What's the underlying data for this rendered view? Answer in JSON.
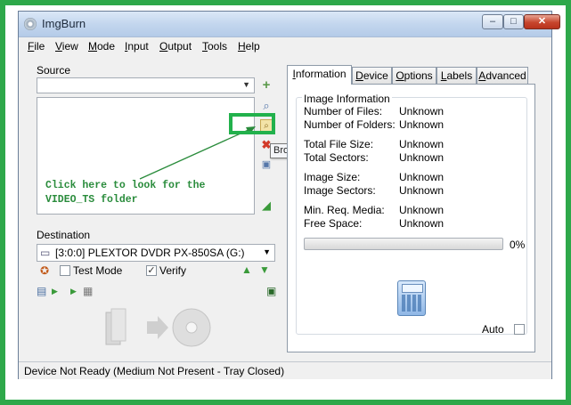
{
  "window": {
    "title": "ImgBurn",
    "min_label": "–",
    "max_label": "□",
    "close_label": "✕"
  },
  "menu": [
    {
      "mnemonic": "F",
      "rest": "ile"
    },
    {
      "mnemonic": "V",
      "rest": "iew"
    },
    {
      "mnemonic": "M",
      "rest": "ode"
    },
    {
      "mnemonic": "I",
      "rest": "nput"
    },
    {
      "mnemonic": "O",
      "rest": "utput"
    },
    {
      "mnemonic": "T",
      "rest": "ools"
    },
    {
      "mnemonic": "H",
      "rest": "elp"
    }
  ],
  "source": {
    "label": "Source",
    "tooltip": "Browse for a folder...",
    "annotation_line1": "Click here to look for the",
    "annotation_line2": "VIDEO_TS folder"
  },
  "destination": {
    "label": "Destination",
    "drive": "[3:0:0] PLEXTOR DVDR   PX-850SA (G:)",
    "test_mode_label": "Test Mode",
    "test_mode_checked": false,
    "verify_label": "Verify",
    "verify_checked": true
  },
  "tabs": [
    {
      "mnemonic": "I",
      "rest": "nformation",
      "active": true
    },
    {
      "mnemonic": "D",
      "rest": "evice"
    },
    {
      "mnemonic": "O",
      "rest": "ptions"
    },
    {
      "mnemonic": "L",
      "rest": "abels"
    },
    {
      "mnemonic": "A",
      "rest": "dvanced"
    }
  ],
  "info": {
    "group_title": "Image Information",
    "rows": [
      {
        "label": "Number of Files:",
        "value": "Unknown"
      },
      {
        "label": "Number of Folders:",
        "value": "Unknown"
      },
      {
        "label": "Total File Size:",
        "value": "Unknown"
      },
      {
        "label": "Total Sectors:",
        "value": "Unknown"
      },
      {
        "label": "Image Size:",
        "value": "Unknown"
      },
      {
        "label": "Image Sectors:",
        "value": "Unknown"
      },
      {
        "label": "Min. Req. Media:",
        "value": "Unknown"
      },
      {
        "label": "Free Space:",
        "value": "Unknown"
      }
    ],
    "progress_percent": 0,
    "progress_label": "0%",
    "auto_label": "Auto",
    "auto_checked": false
  },
  "status": "Device Not Ready (Medium Not Present - Tray Closed)",
  "colors": {
    "highlight": "#22b14c",
    "annotation": "#2a8c3c",
    "frame": "#2ea84a"
  }
}
